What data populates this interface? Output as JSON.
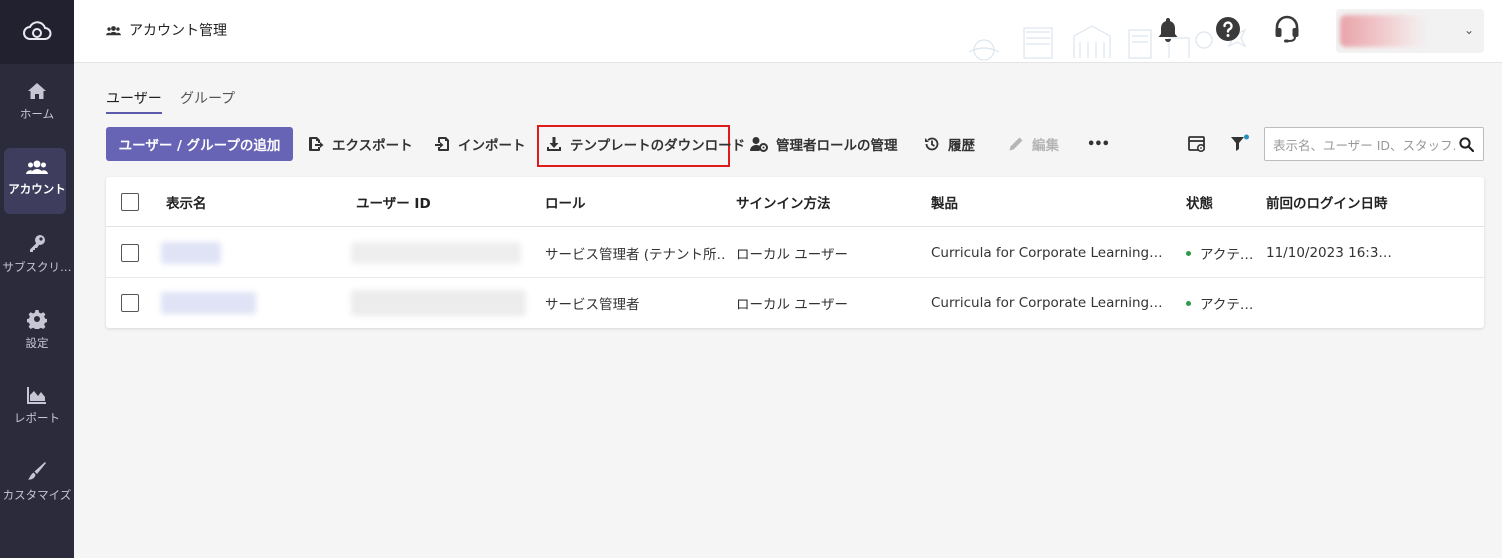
{
  "sidebar": {
    "items": [
      {
        "label": "ホーム"
      },
      {
        "label": "アカウント"
      },
      {
        "label": "サブスクリ…"
      },
      {
        "label": "設定"
      },
      {
        "label": "レポート"
      },
      {
        "label": "カスタマイズ"
      }
    ]
  },
  "header": {
    "title": "アカウント管理"
  },
  "tabs": [
    {
      "label": "ユーザー",
      "active": true
    },
    {
      "label": "グループ",
      "active": false
    }
  ],
  "toolbar": {
    "add_label": "ユーザー / グループの追加",
    "export_label": "エクスポート",
    "import_label": "インポート",
    "template_label": "テンプレートのダウンロード",
    "admin_roles_label": "管理者ロールの管理",
    "history_label": "履歴",
    "edit_label": "編集",
    "more_label": "•••"
  },
  "search": {
    "placeholder": "表示名、ユーザー ID、スタッフ…"
  },
  "table": {
    "columns": [
      "表示名",
      "ユーザー ID",
      "ロール",
      "サインイン方法",
      "製品",
      "状態",
      "前回のログイン日時"
    ],
    "rows": [
      {
        "role": "サービス管理者 (テナント所…",
        "signin": "ローカル ユーザー",
        "product": "Curricula for Corporate Learning…",
        "status": "アクテ…",
        "last_login": "11/10/2023 16:3…"
      },
      {
        "role": "サービス管理者",
        "signin": "ローカル ユーザー",
        "product": "Curricula for Corporate Learning…",
        "status": "アクテ…",
        "last_login": ""
      }
    ]
  },
  "colors": {
    "sidebar_bg": "#2c2b3c",
    "accent": "#6764b5",
    "highlight": "#e01b1b",
    "status_active": "#2b9a4a"
  }
}
